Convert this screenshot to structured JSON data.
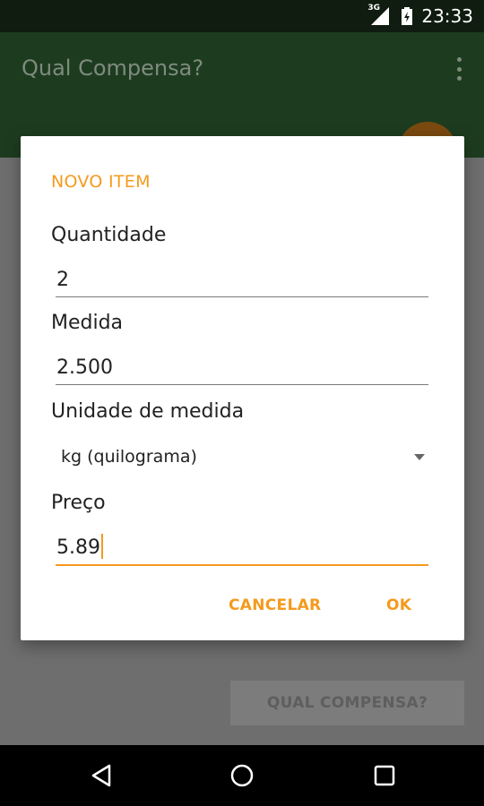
{
  "statusbar": {
    "network": "3G",
    "time": "23:33"
  },
  "appbar": {
    "title": "Qual Compensa?"
  },
  "main": {
    "button_label": "QUAL COMPENSA?"
  },
  "dialog": {
    "title": "NOVO ITEM",
    "fields": [
      {
        "label": "Quantidade",
        "value": "2"
      },
      {
        "label": "Medida",
        "value": "2.500"
      },
      {
        "label": "Unidade de medida",
        "value": "kg (quilograma)"
      },
      {
        "label": "Preço",
        "value": "5.89"
      }
    ],
    "cancel_label": "CANCELAR",
    "ok_label": "OK"
  },
  "colors": {
    "accent": "#F59A1E",
    "primary_dark": "#1D3C1F",
    "fab": "#7A4A10"
  },
  "icons": [
    "signal-icon",
    "battery-icon",
    "overflow-menu-icon",
    "dropdown-arrow-icon",
    "back-icon",
    "home-icon",
    "recents-icon"
  ]
}
